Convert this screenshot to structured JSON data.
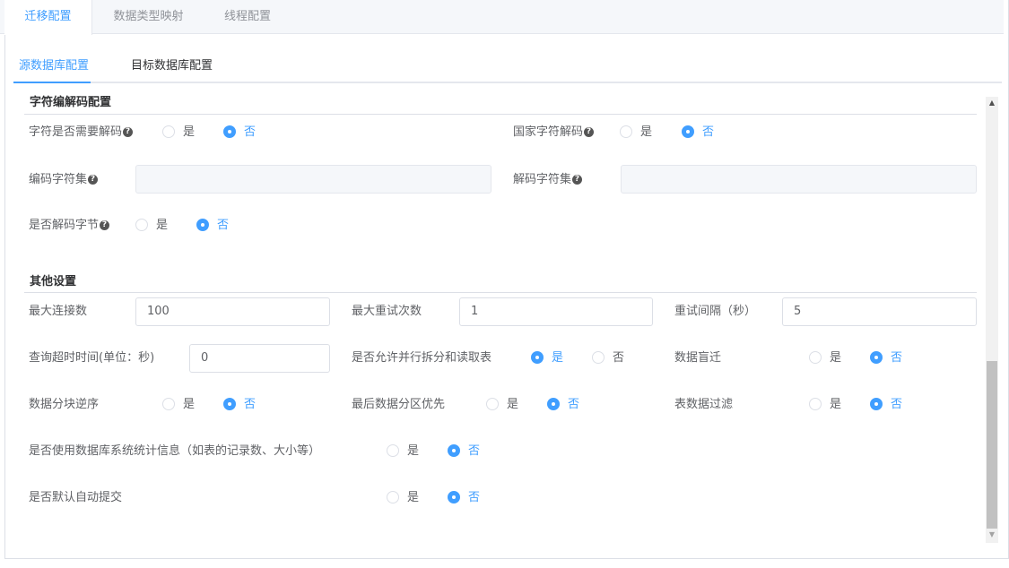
{
  "top_tabs": [
    "迁移配置",
    "数据类型映射",
    "线程配置"
  ],
  "sub_tabs": [
    "源数据库配置",
    "目标数据库配置"
  ],
  "sections": {
    "charset": "字符编解码配置",
    "other": "其他设置"
  },
  "yes": "是",
  "no": "否",
  "help_glyph": "?",
  "charset": {
    "need_decode_label": "字符是否需要解码",
    "need_decode_value": "否",
    "national_decode_label": "国家字符解码",
    "national_decode_value": "否",
    "encode_charset_label": "编码字符集",
    "encode_charset_value": "",
    "decode_charset_label": "解码字符集",
    "decode_charset_value": "",
    "decode_bytes_label": "是否解码字节",
    "decode_bytes_value": "否"
  },
  "other": {
    "max_conn_label": "最大连接数",
    "max_conn_value": "100",
    "max_retry_label": "最大重试次数",
    "max_retry_value": "1",
    "retry_interval_label": "重试间隔（秒）",
    "retry_interval_value": "5",
    "query_timeout_label": "查询超时时间(单位：秒)",
    "query_timeout_value": "0",
    "parallel_split_label": "是否允许并行拆分和读取表",
    "parallel_split_value": "是",
    "blind_migrate_label": "数据盲迁",
    "blind_migrate_value": "否",
    "chunk_reverse_label": "数据分块逆序",
    "chunk_reverse_value": "否",
    "last_partition_label": "最后数据分区优先",
    "last_partition_value": "否",
    "table_filter_label": "表数据过滤",
    "table_filter_value": "否",
    "use_stats_label": "是否使用数据库系统统计信息（如表的记录数、大小等）",
    "use_stats_value": "否",
    "auto_commit_label": "是否默认自动提交",
    "auto_commit_value": "否"
  },
  "colors": {
    "accent": "#409eff",
    "border": "#dcdfe6",
    "tab_bg": "#f5f7fa"
  }
}
